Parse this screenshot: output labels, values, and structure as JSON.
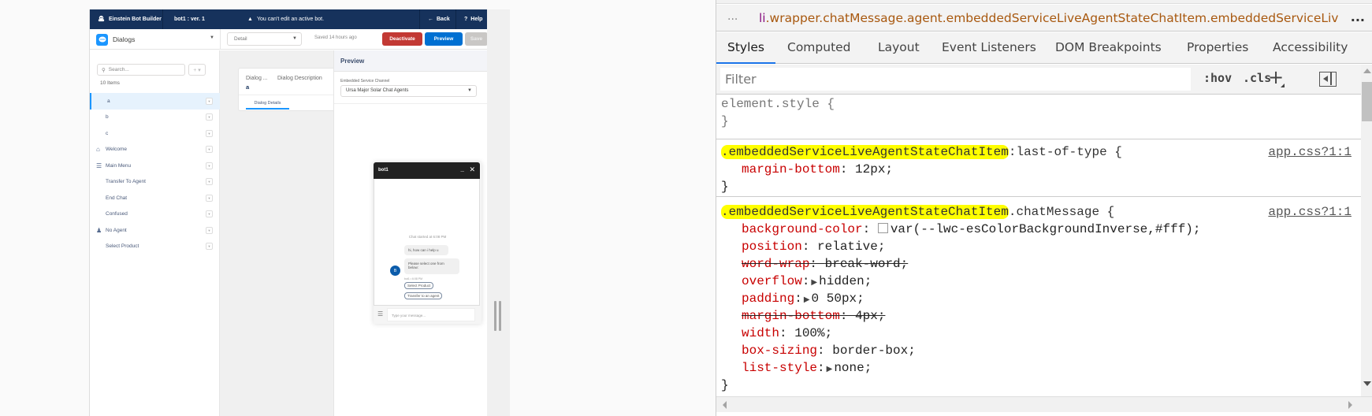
{
  "builder": {
    "header": {
      "app_name": "Einstein Bot Builder",
      "bot_version_label": "bot1 : ver. 1",
      "warning": "You can't edit an active bot.",
      "back_label": "Back",
      "help_label": "Help"
    },
    "subheader": {
      "section_selector": "Dialogs",
      "view_selector": "Detail",
      "saved_status": "Saved 14 hours ago",
      "deactivate_label": "Deactivate",
      "preview_label": "Preview",
      "save_label": "Save"
    },
    "sidebar": {
      "search_placeholder": "Search...",
      "add_label": "+ ▾",
      "item_count": "10 Items",
      "items": [
        {
          "label": "a",
          "icon": "none",
          "selected": true
        },
        {
          "label": "b",
          "icon": "none",
          "selected": false
        },
        {
          "label": "c",
          "icon": "none",
          "selected": false
        },
        {
          "label": "Welcome",
          "icon": "home-icon",
          "selected": false
        },
        {
          "label": "Main Menu",
          "icon": "menu-icon",
          "selected": false
        },
        {
          "label": "Transfer To Agent",
          "icon": "none",
          "selected": false
        },
        {
          "label": "End Chat",
          "icon": "none",
          "selected": false
        },
        {
          "label": "Confused",
          "icon": "none",
          "selected": false
        },
        {
          "label": "No Agent",
          "icon": "agent-icon",
          "selected": false
        },
        {
          "label": "Select Product",
          "icon": "none",
          "selected": false
        }
      ]
    },
    "dialog_card": {
      "name_header": "Dialog ...",
      "description_header": "Dialog Description",
      "name_value": "a",
      "tab_label": "Dialog Details"
    },
    "preview": {
      "title": "Preview",
      "channel_label": "Embedded Service Channel",
      "channel_value": "Ursa Major Solar Chat Agents"
    },
    "chat_widget": {
      "title": "bot1",
      "minimize": "_",
      "close": "✕",
      "started": "Chat started at 6:08 PM",
      "messages": [
        "hi, how can i help u",
        "Please select one from below:"
      ],
      "avatar_initial": "B",
      "meta": "bot1 • 6:08 PM",
      "options": [
        "Select Product",
        "Transfer to an agent"
      ],
      "input_placeholder": "Type your message..."
    }
  },
  "devtools": {
    "breadcrumb_dots": "...",
    "breadcrumb_tag": "li",
    "breadcrumb_path": ".wrapper.chatMessage.agent.embeddedServiceLiveAgentStateChatItem.embeddedServiceLiv",
    "breadcrumb_more": "...",
    "tabs": [
      {
        "label": "Styles",
        "active": true
      },
      {
        "label": "Computed",
        "active": false
      },
      {
        "label": "Layout",
        "active": false
      },
      {
        "label": "Event Listeners",
        "active": false
      },
      {
        "label": "DOM Breakpoints",
        "active": false
      },
      {
        "label": "Properties",
        "active": false
      },
      {
        "label": "Accessibility",
        "active": false
      }
    ],
    "filter_placeholder": "Filter",
    "hov_label": ":hov",
    "cls_label": ".cls",
    "plus_label": "+",
    "rules": {
      "element_style": {
        "selector": "element.style {",
        "close": "}"
      },
      "last_of_type": {
        "selector_highlight": ".embeddedServiceLiveAgentStateChatItem",
        "selector_rest": ":last-of-type {",
        "source": "app.css?1:1",
        "props": [
          {
            "name": "margin-bottom",
            "value": "12px;",
            "overridden": false
          }
        ],
        "close": "}"
      },
      "chat_message": {
        "selector_highlight": ".embeddedServiceLiveAgentStateChatItem",
        "selector_rest": ".chatMessage {",
        "source": "app.css?1:1",
        "props": [
          {
            "name": "background-color",
            "value": "var(--lwc-esColorBackgroundInverse,#fff);",
            "overridden": false,
            "swatch": "#ffffff"
          },
          {
            "name": "position",
            "value": "relative;",
            "overridden": false
          },
          {
            "name": "word-wrap",
            "value": "break-word;",
            "overridden": true
          },
          {
            "name": "overflow",
            "value": "hidden;",
            "overridden": false,
            "expandable": true
          },
          {
            "name": "padding",
            "value": "0 50px;",
            "overridden": false,
            "expandable": true
          },
          {
            "name": "margin-bottom",
            "value": "4px;",
            "overridden": true
          },
          {
            "name": "width",
            "value": "100%;",
            "overridden": false
          },
          {
            "name": "box-sizing",
            "value": "border-box;",
            "overridden": false
          },
          {
            "name": "list-style",
            "value": "none;",
            "overridden": false,
            "expandable": true
          }
        ],
        "close": "}"
      }
    }
  },
  "colors": {
    "header_navy": "#16325c",
    "deactivate_red": "#c23934",
    "preview_blue": "#0070d2",
    "highlight_yellow": "#ffff00",
    "css_property_red": "#c80000"
  }
}
